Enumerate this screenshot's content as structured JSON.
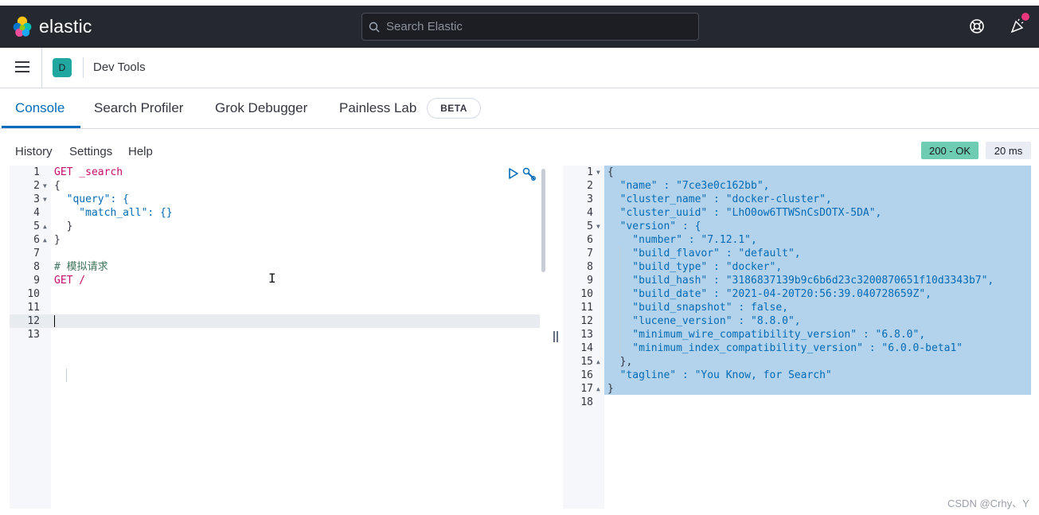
{
  "header": {
    "brand": "elastic",
    "search_placeholder": "Search Elastic"
  },
  "breadcrumb": {
    "avatar_letter": "D",
    "title": "Dev Tools"
  },
  "tabs": [
    {
      "label": "Console",
      "active": true
    },
    {
      "label": "Search Profiler",
      "active": false
    },
    {
      "label": "Grok Debugger",
      "active": false
    },
    {
      "label": "Painless Lab",
      "active": false
    }
  ],
  "beta_badge": "BETA",
  "console_menu": {
    "history": "History",
    "settings": "Settings",
    "help": "Help"
  },
  "response_status": {
    "status": "200 - OK",
    "time": "20 ms"
  },
  "request_editor": {
    "line_numbers": [
      "1",
      "2",
      "3",
      "4",
      "5",
      "6",
      "7",
      "8",
      "9",
      "10",
      "11",
      "12",
      "13"
    ],
    "lines": [
      "GET _search",
      "{",
      "  \"query\": {",
      "    \"match_all\": {}",
      "  }",
      "}",
      "",
      "# 模拟请求",
      "GET /",
      "",
      "",
      "",
      ""
    ]
  },
  "response_editor": {
    "line_numbers": [
      "1",
      "2",
      "3",
      "4",
      "5",
      "6",
      "7",
      "8",
      "9",
      "10",
      "11",
      "12",
      "13",
      "14",
      "15",
      "16",
      "17",
      "18"
    ],
    "lines": [
      "{",
      "  \"name\" : \"7ce3e0c162bb\",",
      "  \"cluster_name\" : \"docker-cluster\",",
      "  \"cluster_uuid\" : \"LhO0ow6TTWSnCsDOTX-5DA\",",
      "  \"version\" : {",
      "    \"number\" : \"7.12.1\",",
      "    \"build_flavor\" : \"default\",",
      "    \"build_type\" : \"docker\",",
      "    \"build_hash\" : \"3186837139b9c6b6d23c3200870651f10d3343b7\",",
      "    \"build_date\" : \"2021-04-20T20:56:39.040728659Z\",",
      "    \"build_snapshot\" : false,",
      "    \"lucene_version\" : \"8.8.0\",",
      "    \"minimum_wire_compatibility_version\" : \"6.8.0\",",
      "    \"minimum_index_compatibility_version\" : \"6.0.0-beta1\"",
      "  },",
      "  \"tagline\" : \"You Know, for Search\"",
      "}",
      ""
    ]
  },
  "watermark": "CSDN @Crhy、Y",
  "colors": {
    "header_bg": "#25282f",
    "accent": "#006bb8",
    "status_ok": "#6dccb1",
    "selection": "#b3d2ec"
  }
}
